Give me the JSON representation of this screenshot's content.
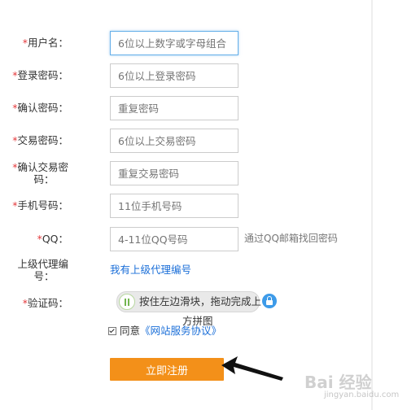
{
  "form": {
    "username": {
      "label": "用户名：",
      "placeholder": "6位以上数字或字母组合"
    },
    "login_password": {
      "label": "登录密码：",
      "placeholder": "6位以上登录密码"
    },
    "confirm_password": {
      "label": "确认密码：",
      "placeholder": "重复密码"
    },
    "trade_password": {
      "label": "交易密码：",
      "placeholder": "6位以上交易密码"
    },
    "confirm_trade_password": {
      "label_line1": "确认交易密",
      "label_line2": "码：",
      "placeholder": "重复交易密码"
    },
    "phone": {
      "label": "手机号码：",
      "placeholder": "11位手机号码"
    },
    "qq": {
      "label": "QQ：",
      "placeholder": "4-11位QQ号码",
      "hint": "通过QQ邮箱找回密码"
    },
    "referrer": {
      "label_line1": "上级代理编",
      "label_line2": "号：",
      "link": "我有上级代理编号"
    },
    "captcha": {
      "label": "验证码：",
      "slider_text": "按住左边滑块，拖动完成上",
      "slider_text2": "方拼图"
    },
    "agree": {
      "text": "同意",
      "protocol": "《网站服务协议》",
      "checked": true
    },
    "submit_label": "立即注册",
    "required_mark": "*"
  },
  "watermark": {
    "text": "Bai 经验",
    "sub": "jingyan.baidu.com"
  },
  "colors": {
    "required": "#e4393c",
    "link": "#1a6ed8",
    "submit": "#f39019",
    "focus_border": "#66afe9"
  }
}
